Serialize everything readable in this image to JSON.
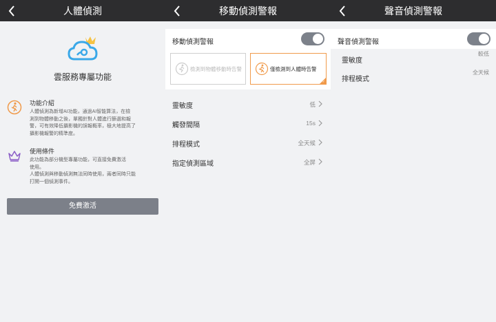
{
  "panel1": {
    "title": "人體偵測",
    "cloud_title": "雲服務專屬功能",
    "intro": {
      "heading": "功能介紹",
      "body": "人體偵測為新增AI功能，通過AI智能算法，在檢\n測到物體移動之後，單獨針對人體進行篩選和報\n警，可有效降低攝影機的誤報概率，極大地提高了\n攝影機報警的精準度。"
    },
    "conditions": {
      "heading": "使用條件",
      "body": "此功能為部分機型專屬功能，可直接免費激活\n使用。\n人體偵測與移動偵測無法同時使用，兩者同時只能\n打開一個偵測事件。"
    },
    "free_button": "免費激活",
    "colors": {
      "accent": "#f09a4a",
      "cloud": "#3aa8e8",
      "crown": "#f5c242",
      "purple": "#8a5cc7"
    }
  },
  "panel2": {
    "title": "移動偵測警報",
    "toggle_label": "移動偵測警報",
    "toggle_on": true,
    "option1": "檢測到物體移動時告警",
    "option2": "僅檢測到人體時告警",
    "selected_option": 2,
    "rows": [
      {
        "label": "靈敏度",
        "value": "低"
      },
      {
        "label": "觸發間隔",
        "value": "15s"
      },
      {
        "label": "排程模式",
        "value": "全天候"
      },
      {
        "label": "指定偵測區域",
        "value": "全屏"
      }
    ]
  },
  "panel3": {
    "title": "聲音偵測警報",
    "toggle_label": "聲音偵測警報",
    "toggle_on": true,
    "rows": [
      {
        "label": "靈敏度",
        "value": "較低"
      },
      {
        "label": "排程模式",
        "value": "全天候"
      }
    ]
  }
}
